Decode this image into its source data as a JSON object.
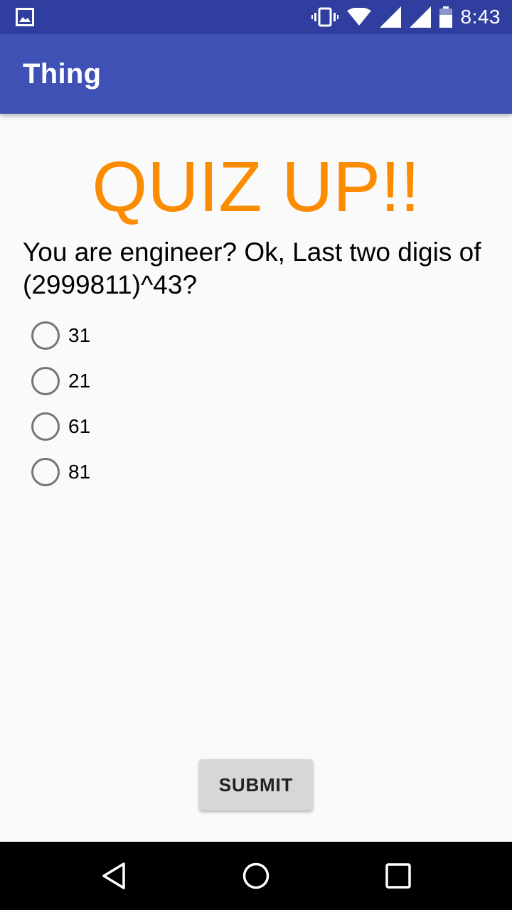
{
  "status_bar": {
    "time": "8:43",
    "icons": [
      "image-notification-icon",
      "vibrate-icon",
      "wifi-icon",
      "signal-icon",
      "signal-icon",
      "battery-icon"
    ]
  },
  "app_bar": {
    "title": "Thing"
  },
  "quiz": {
    "heading": "QUIZ UP!!",
    "question": "You are engineer? Ok, Last two digis of (2999811)^43?",
    "options": [
      {
        "label": "31",
        "selected": false
      },
      {
        "label": "21",
        "selected": false
      },
      {
        "label": "61",
        "selected": false
      },
      {
        "label": "81",
        "selected": false
      }
    ],
    "submit_label": "SUBMIT"
  },
  "colors": {
    "status_bar": "#303f9f",
    "app_bar": "#3f51b5",
    "heading": "#fb8c00",
    "background": "#fafafa"
  },
  "nav_bar": {
    "buttons": [
      "back-icon",
      "home-icon",
      "recents-icon"
    ]
  }
}
